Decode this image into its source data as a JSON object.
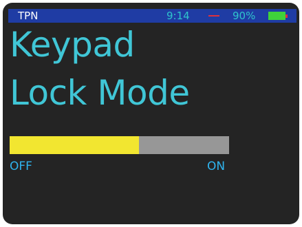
{
  "status_bar": {
    "carrier": "TPN",
    "time": "9:14",
    "battery_percent": "90%",
    "battery_level": 0.9,
    "battery_icon": "battery-icon",
    "indicator_icon": "minus-icon",
    "colors": {
      "background": "#1f3ca4",
      "text": "#2fc4cc",
      "battery": "#3fd23a",
      "indicator": "#e0303c"
    }
  },
  "title": {
    "line1": "Keypad",
    "line2": "Lock Mode",
    "color": "#40c6d6"
  },
  "lock_setting": {
    "level": 0.59,
    "off_label": "OFF",
    "on_label": "ON",
    "fill_color": "#f2e630",
    "track_color": "#979797"
  }
}
